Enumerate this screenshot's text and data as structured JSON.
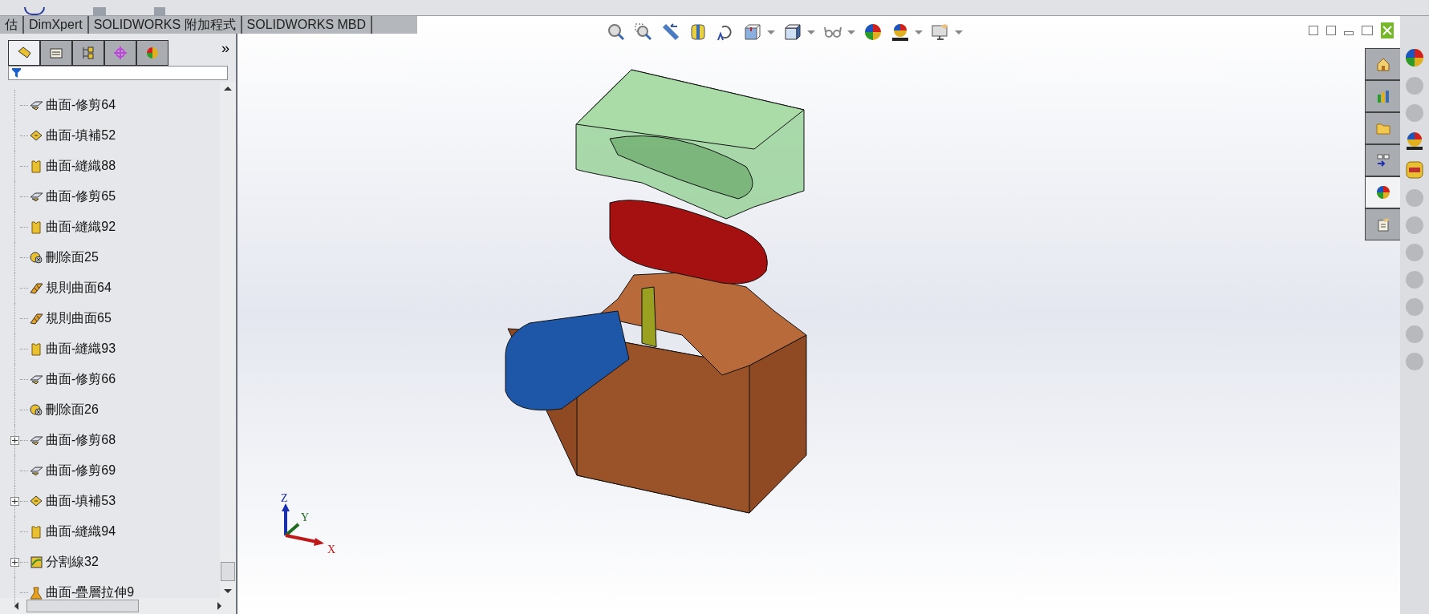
{
  "command_tabs": [
    {
      "label": "估"
    },
    {
      "label": "DimXpert"
    },
    {
      "label": "SOLIDWORKS 附加程式"
    },
    {
      "label": "SOLIDWORKS MBD"
    }
  ],
  "panel_tabs": [
    {
      "kind": "feature",
      "selected": true
    },
    {
      "kind": "property",
      "selected": false
    },
    {
      "kind": "config",
      "selected": false
    },
    {
      "kind": "dimxpert",
      "selected": false
    },
    {
      "kind": "display",
      "selected": false
    }
  ],
  "panel_more": "»",
  "tree": [
    {
      "kind": "trim",
      "label": "曲面-修剪64",
      "expandable": false
    },
    {
      "kind": "fill",
      "label": "曲面-填補52",
      "expandable": false
    },
    {
      "kind": "knit",
      "label": "曲面-縫織88",
      "expandable": false
    },
    {
      "kind": "trim",
      "label": "曲面-修剪65",
      "expandable": false
    },
    {
      "kind": "knit",
      "label": "曲面-縫織92",
      "expandable": false
    },
    {
      "kind": "delete",
      "label": "刪除面25",
      "expandable": false
    },
    {
      "kind": "ruled",
      "label": "規則曲面64",
      "expandable": false
    },
    {
      "kind": "ruled",
      "label": "規則曲面65",
      "expandable": false
    },
    {
      "kind": "knit",
      "label": "曲面-縫織93",
      "expandable": false
    },
    {
      "kind": "trim",
      "label": "曲面-修剪66",
      "expandable": false
    },
    {
      "kind": "delete",
      "label": "刪除面26",
      "expandable": false
    },
    {
      "kind": "trim",
      "label": "曲面-修剪68",
      "expandable": true
    },
    {
      "kind": "trim",
      "label": "曲面-修剪69",
      "expandable": false
    },
    {
      "kind": "fill",
      "label": "曲面-填補53",
      "expandable": true
    },
    {
      "kind": "knit",
      "label": "曲面-縫織94",
      "expandable": false
    },
    {
      "kind": "split",
      "label": "分割線32",
      "expandable": true
    },
    {
      "kind": "loft",
      "label": "曲面-疊層拉伸9",
      "expandable": false
    }
  ],
  "heads_up_toolbar": [
    {
      "kind": "zoom-fit",
      "dropdown": false
    },
    {
      "kind": "zoom-area",
      "dropdown": false
    },
    {
      "kind": "previous-view",
      "dropdown": false
    },
    {
      "kind": "section",
      "dropdown": false
    },
    {
      "kind": "dynamic",
      "dropdown": false
    },
    {
      "kind": "view-orient",
      "dropdown": true
    },
    {
      "kind": "display-style",
      "dropdown": true
    },
    {
      "kind": "hide-show",
      "dropdown": true
    },
    {
      "kind": "appearance",
      "dropdown": false
    },
    {
      "kind": "scene",
      "dropdown": true
    },
    {
      "kind": "view-settings",
      "dropdown": true
    }
  ],
  "task_tabs": [
    {
      "kind": "home",
      "selected": false
    },
    {
      "kind": "library",
      "selected": false
    },
    {
      "kind": "folder",
      "selected": false
    },
    {
      "kind": "palette",
      "selected": false
    },
    {
      "kind": "appearance",
      "selected": true
    },
    {
      "kind": "custom",
      "selected": false
    }
  ],
  "triad": {
    "z": "Z",
    "y": "Y",
    "x": "X"
  }
}
